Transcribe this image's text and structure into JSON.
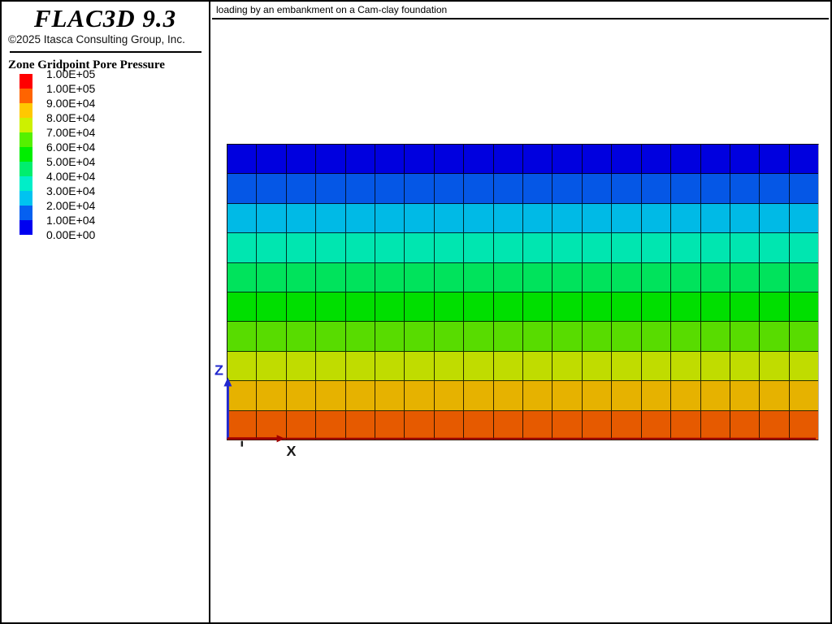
{
  "sidebar": {
    "logo": "FLAC3D 9.3",
    "copyright": "©2025 Itasca Consulting Group, Inc.",
    "legend_title": "Zone Gridpoint Pore Pressure",
    "legend": {
      "labels": [
        "1.00E+05",
        "1.00E+05",
        "9.00E+04",
        "8.00E+04",
        "7.00E+04",
        "6.00E+04",
        "5.00E+04",
        "4.00E+04",
        "3.00E+04",
        "2.00E+04",
        "1.00E+04",
        "0.00E+00"
      ],
      "colors": [
        "#FF0000",
        "#FF6400",
        "#FFC800",
        "#CDF000",
        "#55F000",
        "#00EE00",
        "#00EE6E",
        "#00EEC8",
        "#00C3F0",
        "#0560F0",
        "#0000F0"
      ]
    }
  },
  "plot": {
    "caption": "loading by an embankment on a Cam-clay foundation",
    "axes": {
      "x_label": "X",
      "z_label": "Z",
      "x_color": "#A00000",
      "z_color": "#2128CE",
      "x_label_color": "#1a1a1a",
      "y_tick_color": "#222222"
    },
    "grid": {
      "columns": 20,
      "rows": 10,
      "line_color": "#101010",
      "bottom_boundary_color": "#990000"
    }
  },
  "chart_data": {
    "type": "heatmap",
    "title": "Zone Gridpoint Pore Pressure",
    "caption": "loading by an embankment on a Cam-clay foundation",
    "grid": {
      "columns": 20,
      "rows": 10
    },
    "value_min": 0,
    "value_max": 100000,
    "legend_labels": [
      "1.00E+05",
      "1.00E+05",
      "9.00E+04",
      "8.00E+04",
      "7.00E+04",
      "6.00E+04",
      "5.00E+04",
      "4.00E+04",
      "3.00E+04",
      "2.00E+04",
      "1.00E+04",
      "0.00E+00"
    ],
    "rows_top_to_bottom": [
      {
        "pore_pressure_range": [
          0,
          10000
        ],
        "color": "#0000DF"
      },
      {
        "pore_pressure_range": [
          10000,
          20000
        ],
        "color": "#0557E6"
      },
      {
        "pore_pressure_range": [
          20000,
          30000
        ],
        "color": "#00BAE6"
      },
      {
        "pore_pressure_range": [
          30000,
          40000
        ],
        "color": "#00E6B0"
      },
      {
        "pore_pressure_range": [
          40000,
          50000
        ],
        "color": "#00E35C"
      },
      {
        "pore_pressure_range": [
          50000,
          60000
        ],
        "color": "#00DF00"
      },
      {
        "pore_pressure_range": [
          60000,
          70000
        ],
        "color": "#58DC00"
      },
      {
        "pore_pressure_range": [
          70000,
          80000
        ],
        "color": "#C0DC00"
      },
      {
        "pore_pressure_range": [
          80000,
          90000
        ],
        "color": "#E6B200"
      },
      {
        "pore_pressure_range": [
          90000,
          100000
        ],
        "color": "#E65A00"
      }
    ]
  }
}
